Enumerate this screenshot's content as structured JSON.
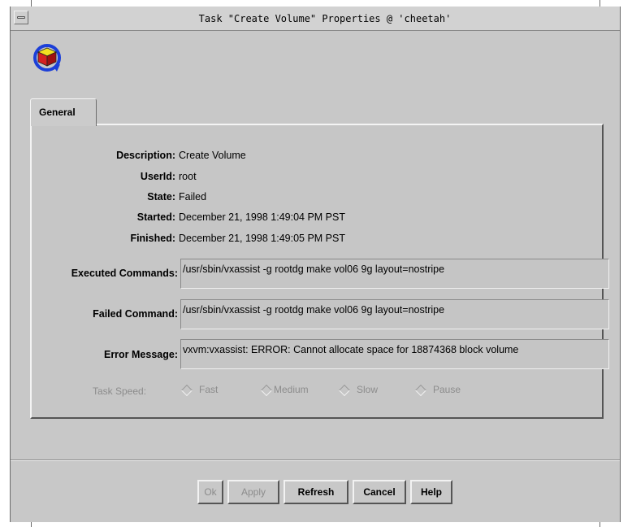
{
  "window": {
    "title": "Task \"Create Volume\" Properties @ 'cheetah'"
  },
  "tabs": [
    {
      "label": "General"
    }
  ],
  "details": {
    "description_label": "Description:",
    "description_value": "Create Volume",
    "userid_label": "UserId:",
    "userid_value": "root",
    "state_label": "State:",
    "state_value": "Failed",
    "started_label": "Started:",
    "started_value": "December 21, 1998 1:49:04 PM PST",
    "finished_label": "Finished:",
    "finished_value": "December 21, 1998 1:49:05 PM PST"
  },
  "fields": {
    "executed_label": "Executed Commands:",
    "executed_value": "/usr/sbin/vxassist  -g rootdg   make vol06 9g layout=nostripe",
    "failed_label": "Failed Command:",
    "failed_value": "/usr/sbin/vxassist  -g rootdg   make vol06 9g layout=nostripe",
    "error_label": "Error Message:",
    "error_value": "vxvm:vxassist: ERROR: Cannot allocate space for 18874368 block volume"
  },
  "task_speed": {
    "label": "Task Speed:",
    "options": [
      "Fast",
      "Medium",
      "Slow",
      "Pause"
    ]
  },
  "buttons": {
    "ok": "Ok",
    "apply": "Apply",
    "refresh": "Refresh",
    "cancel": "Cancel",
    "help": "Help"
  },
  "icons": {
    "app": "task-volume-icon",
    "window_menu": "window-menu-icon"
  }
}
